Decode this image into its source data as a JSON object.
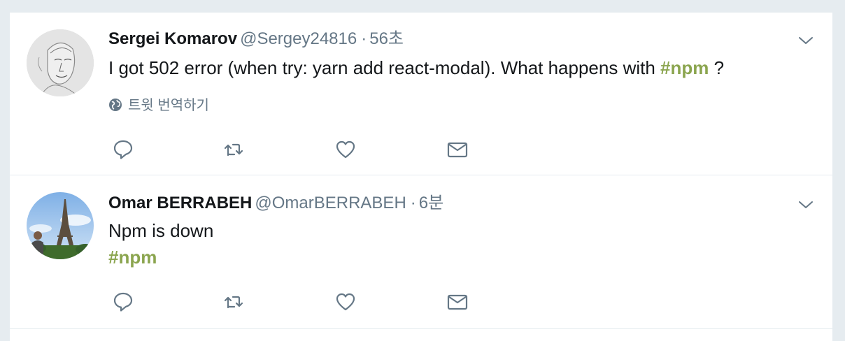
{
  "tweets": [
    {
      "fullname": "Sergei Komarov",
      "username": "@Sergey24816",
      "separator": "·",
      "timestamp": "56초",
      "text_before": "I got 502 error (when try: yarn add react-modal). What happens with ",
      "hashtag": "#npm",
      "text_after": " ?",
      "translate_label": "트윗 번역하기",
      "avatar_icon": "sketch-portrait-avatar"
    },
    {
      "fullname": "Omar BERRABEH",
      "username": "@OmarBERRABEH",
      "separator": "·",
      "timestamp": "6분",
      "text": "Npm is down",
      "hashtag": "#npm",
      "avatar_icon": "eiffel-tower-photo-avatar"
    }
  ],
  "icons": {
    "reply": "reply-icon",
    "retweet": "retweet-icon",
    "like": "like-icon",
    "direct_message": "envelope-icon",
    "more": "chevron-down-icon",
    "translate": "globe-icon"
  },
  "colors": {
    "hashtag": "#8ba54f",
    "secondary_text": "#657786",
    "primary_text": "#14171a",
    "background": "#e6ecf0"
  }
}
